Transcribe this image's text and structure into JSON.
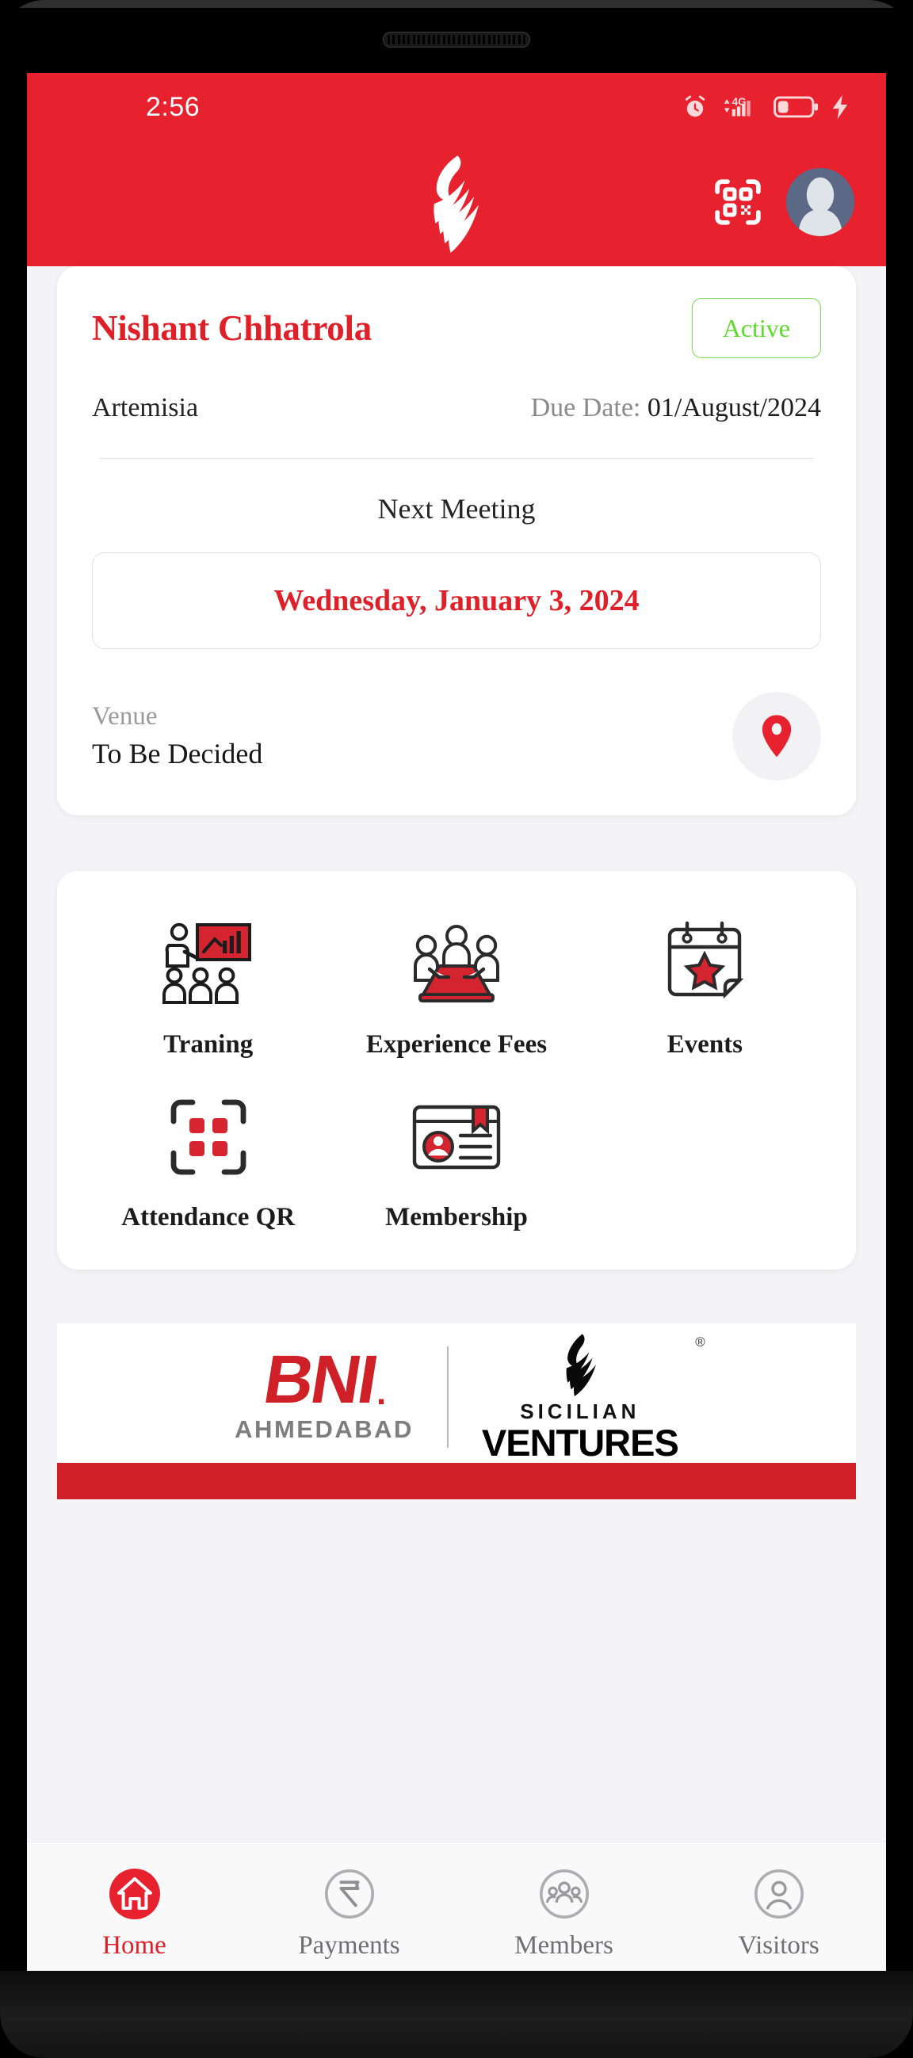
{
  "status_bar": {
    "time": "2:56",
    "icons": [
      "alarm-clock-icon",
      "network-4g-icon",
      "signal-bars-icon",
      "battery-icon",
      "charging-bolt-icon"
    ],
    "network_label": "4G"
  },
  "app_bar": {
    "logo": "bni-flame-logo",
    "qr_icon": "qr-scan-icon",
    "avatar": "user-avatar-icon"
  },
  "member": {
    "name": "Nishant Chhatrola",
    "status": "Active",
    "chapter": "Artemisia",
    "due_label": "Due Date: ",
    "due_date": "01/August/2024",
    "next_meeting_title": "Next Meeting",
    "meeting_date": "Wednesday, January 3, 2024",
    "venue_label": "Venue",
    "venue_value": "To Be Decided",
    "map_icon": "location-pin-icon"
  },
  "menu": {
    "items": [
      {
        "label": "Traning",
        "icon": "training-presentation-icon"
      },
      {
        "label": "Experience\nFees",
        "icon": "meeting-table-icon"
      },
      {
        "label": "Events",
        "icon": "calendar-star-icon"
      },
      {
        "label": "Attendance\nQR",
        "icon": "qr-scan-icon"
      },
      {
        "label": "Membership",
        "icon": "membership-card-icon"
      }
    ]
  },
  "banner": {
    "bni_text": "BNI",
    "bni_sub": "AHMEDABAD",
    "sv_top": "SICILIAN",
    "sv_bottom": "VENTURES",
    "registered_mark": "®"
  },
  "bottom_nav": {
    "items": [
      {
        "label": "Home",
        "icon": "home-icon",
        "active": true
      },
      {
        "label": "Payments",
        "icon": "rupee-icon",
        "active": false
      },
      {
        "label": "Members",
        "icon": "members-icon",
        "active": false
      },
      {
        "label": "Visitors",
        "icon": "visitor-icon",
        "active": false
      }
    ]
  },
  "colors": {
    "brand_red": "#e8212e",
    "accent_red": "#e02029",
    "active_green": "#5fd92e",
    "page_bg": "#f4f4f7",
    "nav_inactive": "#6f6f73"
  }
}
